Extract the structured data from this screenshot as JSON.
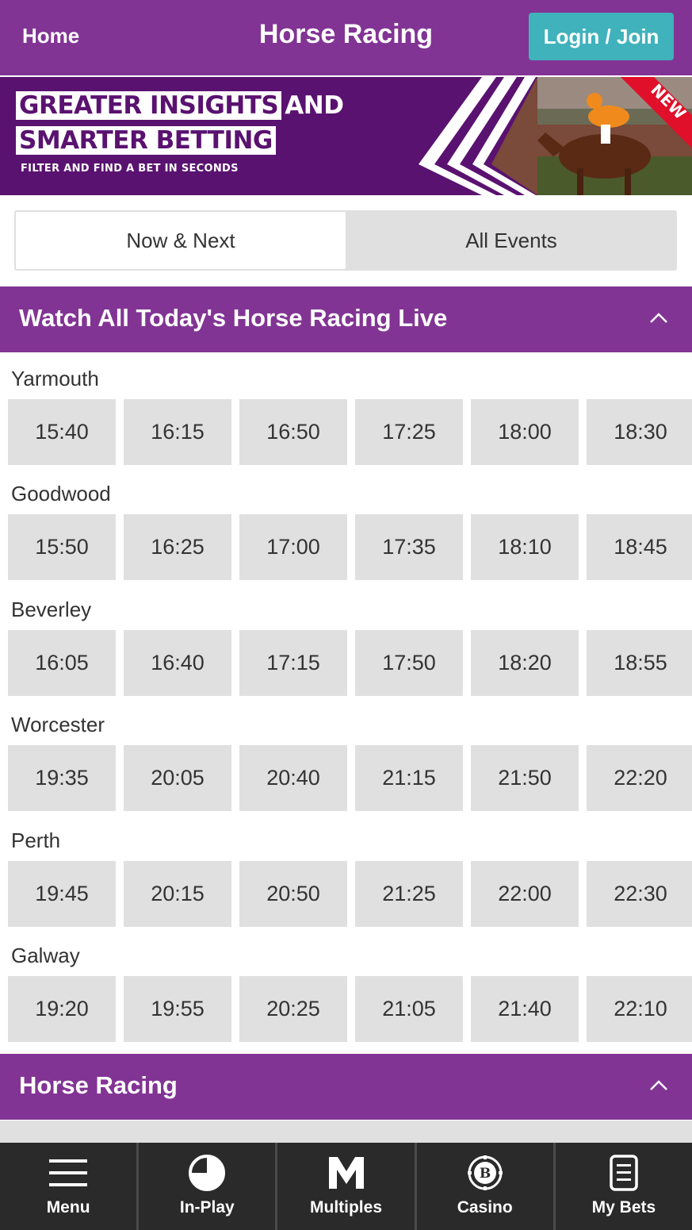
{
  "header": {
    "home_label": "Home",
    "title": "Horse Racing",
    "login_label": "Login / Join"
  },
  "banner": {
    "line1_highlight": "GREATER INSIGHTS",
    "line1_plain": "AND",
    "line2_highlight": "SMARTER BETTING",
    "subline": "FILTER AND FIND A BET IN SECONDS",
    "badge": "NEW"
  },
  "tabs": [
    {
      "label": "Now & Next",
      "active": true
    },
    {
      "label": "All Events",
      "active": false
    }
  ],
  "live_section": {
    "title": "Watch All Today's Horse Racing Live"
  },
  "meetings": [
    {
      "name": "Yarmouth",
      "times": [
        "15:40",
        "16:15",
        "16:50",
        "17:25",
        "18:00",
        "18:30"
      ]
    },
    {
      "name": "Goodwood",
      "times": [
        "15:50",
        "16:25",
        "17:00",
        "17:35",
        "18:10",
        "18:45"
      ]
    },
    {
      "name": "Beverley",
      "times": [
        "16:05",
        "16:40",
        "17:15",
        "17:50",
        "18:20",
        "18:55"
      ]
    },
    {
      "name": "Worcester",
      "times": [
        "19:35",
        "20:05",
        "20:40",
        "21:15",
        "21:50",
        "22:20"
      ]
    },
    {
      "name": "Perth",
      "times": [
        "19:45",
        "20:15",
        "20:50",
        "21:25",
        "22:00",
        "22:30"
      ]
    },
    {
      "name": "Galway",
      "times": [
        "19:20",
        "19:55",
        "20:25",
        "21:05",
        "21:40",
        "22:10"
      ]
    }
  ],
  "racing_section": {
    "title": "Horse Racing"
  },
  "bottom_nav": [
    {
      "label": "Menu",
      "icon": "menu-icon"
    },
    {
      "label": "In-Play",
      "icon": "in-play-icon"
    },
    {
      "label": "Multiples",
      "icon": "multiples-icon"
    },
    {
      "label": "Casino",
      "icon": "casino-icon"
    },
    {
      "label": "My Bets",
      "icon": "my-bets-icon"
    }
  ],
  "colors": {
    "brand_purple": "#823494",
    "banner_purple": "#5a1270",
    "login_teal": "#3fb2bc",
    "tile_grey": "#e0e0e0",
    "nav_dark": "#2a2a2a"
  }
}
